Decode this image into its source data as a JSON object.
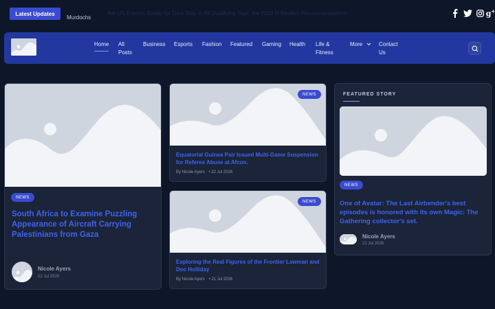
{
  "topbar": {
    "latest_label": "Latest Updates",
    "ticker_source": "Murdochs",
    "ticker_text": "Are US Experts Ready for Dark Side to All Qualifying Start: the 2023 in Reuters Recommendations",
    "social": [
      "facebook-icon",
      "twitter-icon",
      "instagram-icon",
      "google-plus-icon"
    ]
  },
  "nav": {
    "items": [
      "Home",
      "All Posts",
      "Business",
      "Esports",
      "Fashion",
      "Featured",
      "Gaming",
      "Health",
      "Life & Fitness",
      "More",
      "Contact Us"
    ],
    "active": "Home"
  },
  "cards": {
    "main": {
      "badge": "NEWS",
      "title": "South Africa to Examine Puzzling Appearance of Aircraft Carrying Palestinians from Gaza",
      "author": "Nicole Ayers",
      "date": "22 Jul 2026"
    },
    "mid_top": {
      "badge": "NEWS",
      "title": "Equatorial Guinea Pair Issued Multi-Game Suspension for Referee Abuse at Afcon.",
      "byline": "By Nicole Ayers",
      "date": "• 22 Jul 2026"
    },
    "mid_bottom": {
      "badge": "NEWS",
      "title": "Exploring the Real Figures of the Frontier Lawman and Doc Holliday",
      "byline": "By Nicole Ayers",
      "date": "• 21 Jul 2026"
    },
    "featured": {
      "section_label": "FEATURED STORY",
      "badge": "NEWS",
      "title": "One of Avatar: The Last Airbender's best episodes is honored with its own Magic: The Gathering collector's set.",
      "author": "Nicole Ayers",
      "date": "21 Jul 2026"
    }
  },
  "colors": {
    "background": "#0e1629",
    "navbar": "#2238a0",
    "accent": "#3a4bd0",
    "title": "#3e63f0",
    "card": "#1b2438"
  }
}
